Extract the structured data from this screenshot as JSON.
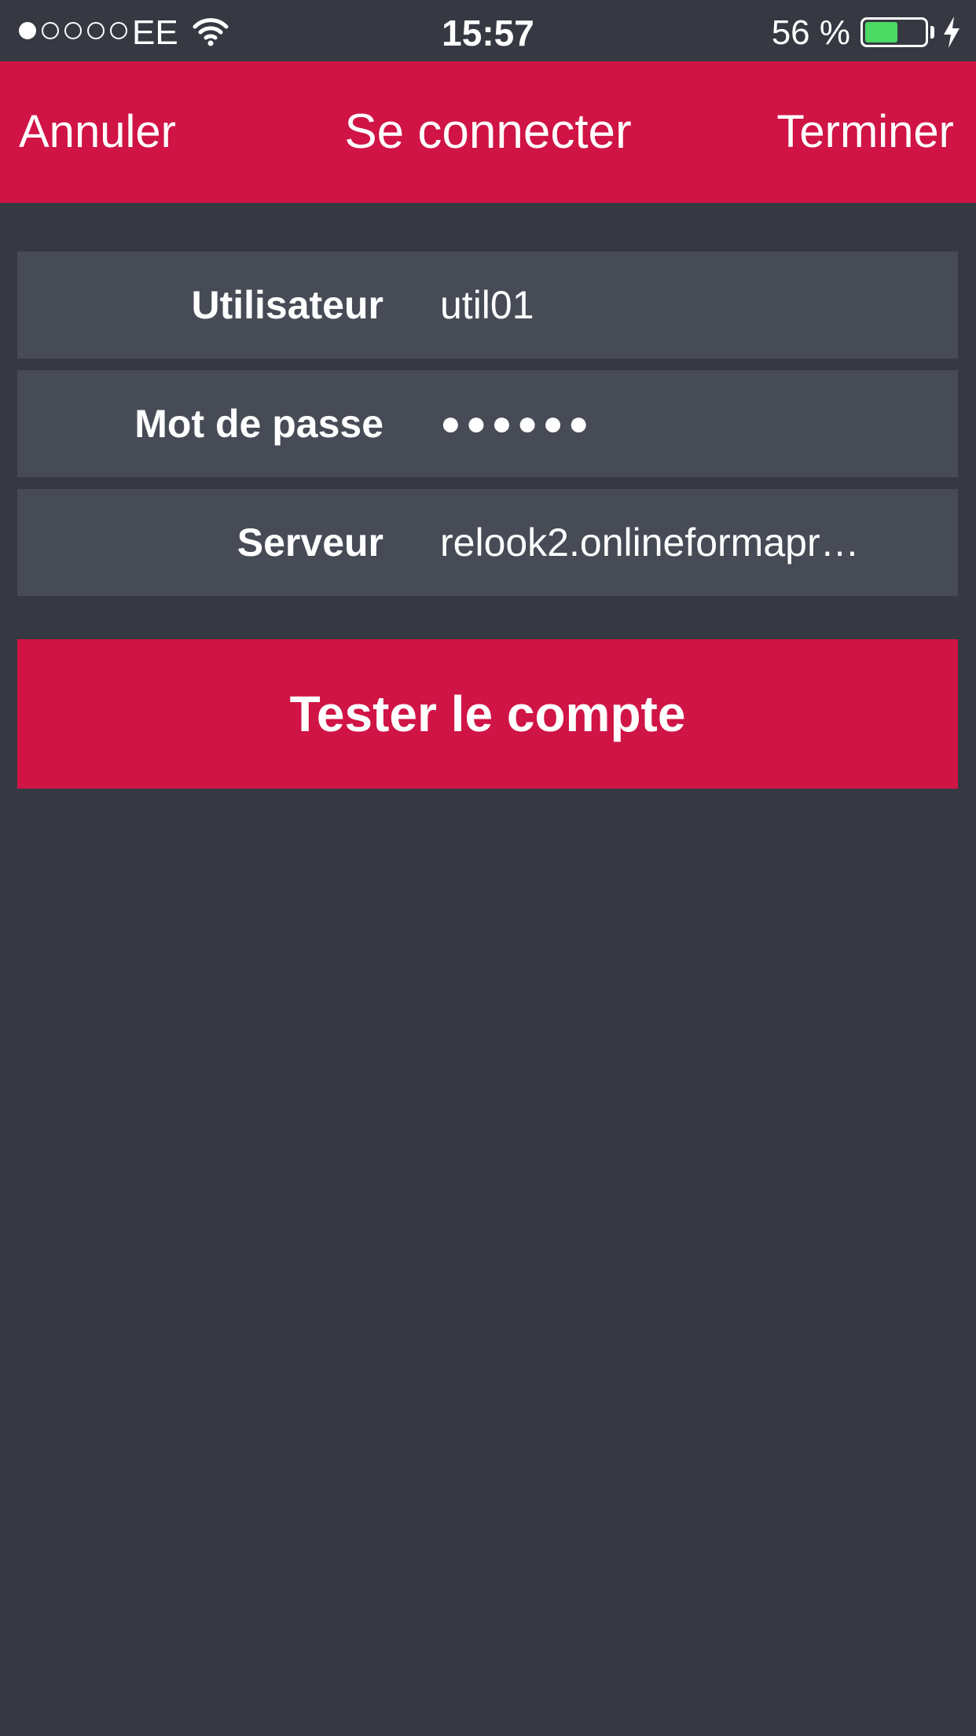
{
  "status_bar": {
    "signal_strength": 1,
    "signal_total": 5,
    "carrier": "EE",
    "time": "15:57",
    "battery_percent_label": "56 %",
    "battery_level": 0.56,
    "battery_color": "#4cd964",
    "icons": [
      "wifi-icon",
      "battery-icon",
      "charging-bolt-icon"
    ]
  },
  "nav": {
    "left_button": "Annuler",
    "title": "Se connecter",
    "right_button": "Terminer",
    "background": "#d01445"
  },
  "form": {
    "user": {
      "label": "Utilisateur",
      "value": "util01"
    },
    "password": {
      "label": "Mot de passe",
      "value": "●●●●●●"
    },
    "server": {
      "label": "Serveur",
      "value": "relook2.onlineformapr…"
    }
  },
  "actions": {
    "test_account": "Tester le compte"
  },
  "colors": {
    "background": "#363942",
    "row_background": "#474b56",
    "accent": "#d01445"
  }
}
